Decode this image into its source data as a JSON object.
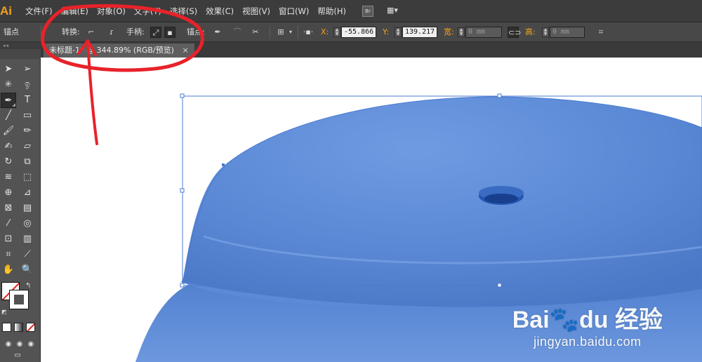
{
  "app": {
    "logo": "Ai"
  },
  "menu": [
    {
      "label": "文件(F)"
    },
    {
      "label": "编辑(E)"
    },
    {
      "label": "对象(O)"
    },
    {
      "label": "文字(T)"
    },
    {
      "label": "选择(S)"
    },
    {
      "label": "效果(C)"
    },
    {
      "label": "视图(V)"
    },
    {
      "label": "窗口(W)"
    },
    {
      "label": "帮助(H)"
    }
  ],
  "menubar_buttons": {
    "bridge": "Br",
    "workspace_icon": "arrange-documents-icon"
  },
  "control": {
    "anchor_label": "锚点",
    "convert_label": "转换:",
    "handles_label": "手柄:",
    "anchors_label": "锚点:",
    "x_label": "X:",
    "x_value": "-55.866",
    "y_label": "Y:",
    "y_value": "139.217",
    "w_label": "宽:",
    "w_value": "0 mm",
    "h_label": "高:",
    "h_value": "0 mm"
  },
  "document_tab": {
    "title": "未标题-1*",
    "zoom": "344.89%",
    "mode": "(RGB/预览)",
    "close": "×"
  },
  "tools": [
    "selection-tool",
    "direct-selection-tool",
    "magic-wand-tool",
    "lasso-tool",
    "pen-tool",
    "type-tool",
    "line-segment-tool",
    "rectangle-tool",
    "paintbrush-tool",
    "pencil-tool",
    "blob-brush-tool",
    "eraser-tool",
    "rotate-tool",
    "scale-tool",
    "width-tool",
    "free-transform-tool",
    "shape-builder-tool",
    "perspective-grid-tool",
    "mesh-tool",
    "gradient-tool",
    "eyedropper-tool",
    "blend-tool",
    "symbol-sprayer-tool",
    "column-graph-tool",
    "artboard-tool",
    "slice-tool",
    "hand-tool",
    "zoom-tool"
  ],
  "type_tool_glyph": "T",
  "colors": {
    "accent": "#f7a21b",
    "annotation": "#e8222a",
    "object": "#5b8bd6",
    "selection": "#4a7bd0"
  },
  "watermark": {
    "brand": "Bai",
    "brand_tail": "du",
    "brand_cn": "经验",
    "url": "jingyan.baidu.com"
  }
}
